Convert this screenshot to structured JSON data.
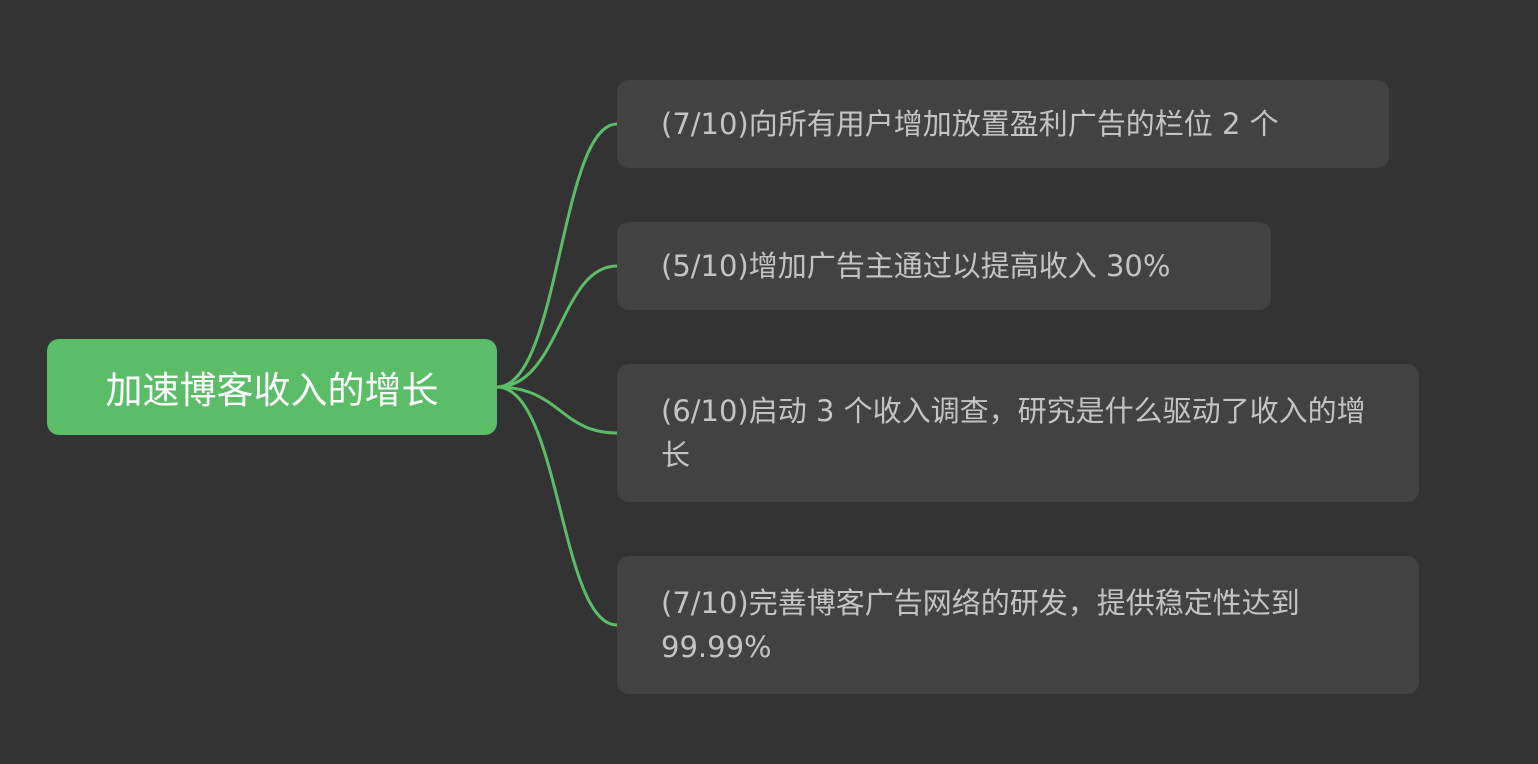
{
  "mindmap": {
    "root": {
      "label": "加速博客收入的增长"
    },
    "branches": [
      {
        "label": "(7/10)向所有用户增加放置盈利广告的栏位 2 个"
      },
      {
        "label": "(5/10)增加广告主通过以提高收入 30%"
      },
      {
        "label": "(6/10)启动 3 个收入调查，研究是什么驱动了收入的增长"
      },
      {
        "label": "(7/10)完善博客广告网络的研发，提供稳定性达到 99.99%"
      }
    ]
  },
  "colors": {
    "background": "#333333",
    "root_fill": "#5bbd67",
    "root_text": "#ffffff",
    "branch_fill": "#424242",
    "branch_text": "#c4c4c4",
    "connector": "#5bbd67"
  }
}
